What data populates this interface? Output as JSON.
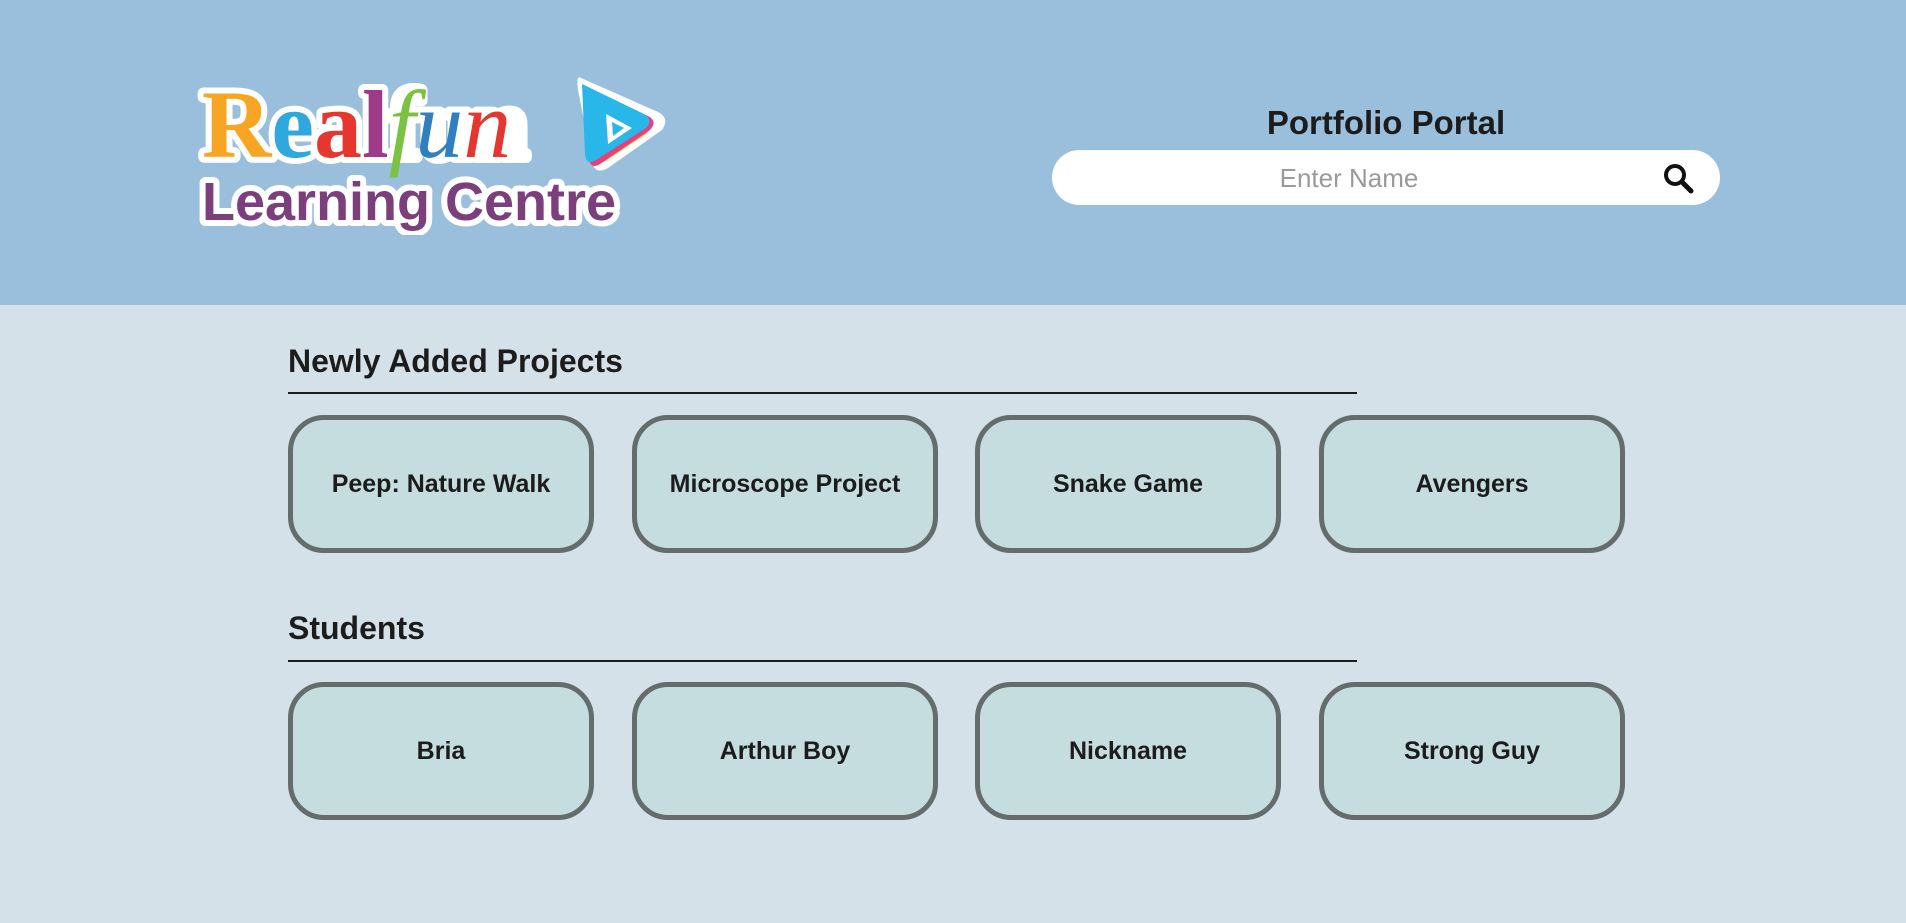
{
  "header": {
    "logo": {
      "line1": "Realfun",
      "line2": "Learning Centre"
    },
    "portal_title": "Portfolio Portal",
    "search": {
      "placeholder": "Enter Name"
    }
  },
  "projects": {
    "title": "Newly Added Projects",
    "items": [
      {
        "label": "Peep: Nature Walk"
      },
      {
        "label": "Microscope Project"
      },
      {
        "label": "Snake Game"
      },
      {
        "label": "Avengers"
      }
    ]
  },
  "students": {
    "title": "Students",
    "items": [
      {
        "label": "Bria"
      },
      {
        "label": "Arthur Boy"
      },
      {
        "label": "Nickname"
      },
      {
        "label": "Strong Guy"
      }
    ]
  },
  "colors": {
    "header_bg": "#99bfdd",
    "page_bg": "#d4e1e8",
    "card_bg": "#c5ddde",
    "card_border": "#646d6b"
  },
  "icons": {
    "search": "search-icon",
    "logo_play": "play-icon"
  }
}
